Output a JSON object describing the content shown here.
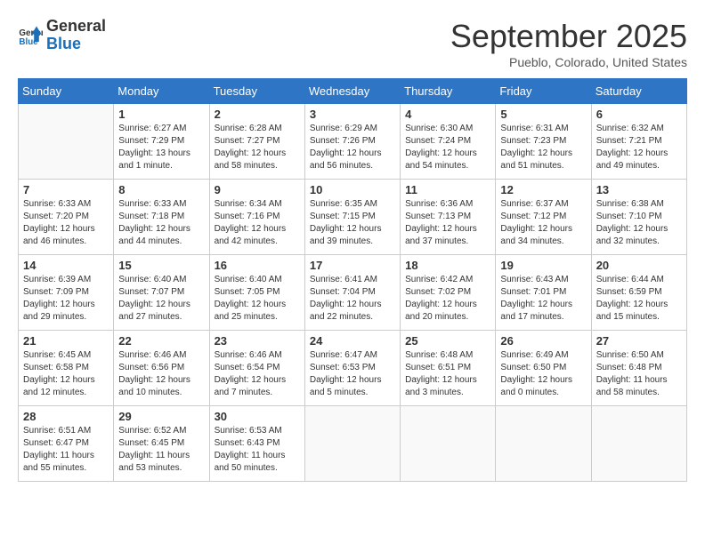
{
  "logo": {
    "line1": "General",
    "line2": "Blue"
  },
  "title": "September 2025",
  "subtitle": "Pueblo, Colorado, United States",
  "days_header": [
    "Sunday",
    "Monday",
    "Tuesday",
    "Wednesday",
    "Thursday",
    "Friday",
    "Saturday"
  ],
  "weeks": [
    [
      {
        "day": "",
        "info": ""
      },
      {
        "day": "1",
        "info": "Sunrise: 6:27 AM\nSunset: 7:29 PM\nDaylight: 13 hours\nand 1 minute."
      },
      {
        "day": "2",
        "info": "Sunrise: 6:28 AM\nSunset: 7:27 PM\nDaylight: 12 hours\nand 58 minutes."
      },
      {
        "day": "3",
        "info": "Sunrise: 6:29 AM\nSunset: 7:26 PM\nDaylight: 12 hours\nand 56 minutes."
      },
      {
        "day": "4",
        "info": "Sunrise: 6:30 AM\nSunset: 7:24 PM\nDaylight: 12 hours\nand 54 minutes."
      },
      {
        "day": "5",
        "info": "Sunrise: 6:31 AM\nSunset: 7:23 PM\nDaylight: 12 hours\nand 51 minutes."
      },
      {
        "day": "6",
        "info": "Sunrise: 6:32 AM\nSunset: 7:21 PM\nDaylight: 12 hours\nand 49 minutes."
      }
    ],
    [
      {
        "day": "7",
        "info": "Sunrise: 6:33 AM\nSunset: 7:20 PM\nDaylight: 12 hours\nand 46 minutes."
      },
      {
        "day": "8",
        "info": "Sunrise: 6:33 AM\nSunset: 7:18 PM\nDaylight: 12 hours\nand 44 minutes."
      },
      {
        "day": "9",
        "info": "Sunrise: 6:34 AM\nSunset: 7:16 PM\nDaylight: 12 hours\nand 42 minutes."
      },
      {
        "day": "10",
        "info": "Sunrise: 6:35 AM\nSunset: 7:15 PM\nDaylight: 12 hours\nand 39 minutes."
      },
      {
        "day": "11",
        "info": "Sunrise: 6:36 AM\nSunset: 7:13 PM\nDaylight: 12 hours\nand 37 minutes."
      },
      {
        "day": "12",
        "info": "Sunrise: 6:37 AM\nSunset: 7:12 PM\nDaylight: 12 hours\nand 34 minutes."
      },
      {
        "day": "13",
        "info": "Sunrise: 6:38 AM\nSunset: 7:10 PM\nDaylight: 12 hours\nand 32 minutes."
      }
    ],
    [
      {
        "day": "14",
        "info": "Sunrise: 6:39 AM\nSunset: 7:09 PM\nDaylight: 12 hours\nand 29 minutes."
      },
      {
        "day": "15",
        "info": "Sunrise: 6:40 AM\nSunset: 7:07 PM\nDaylight: 12 hours\nand 27 minutes."
      },
      {
        "day": "16",
        "info": "Sunrise: 6:40 AM\nSunset: 7:05 PM\nDaylight: 12 hours\nand 25 minutes."
      },
      {
        "day": "17",
        "info": "Sunrise: 6:41 AM\nSunset: 7:04 PM\nDaylight: 12 hours\nand 22 minutes."
      },
      {
        "day": "18",
        "info": "Sunrise: 6:42 AM\nSunset: 7:02 PM\nDaylight: 12 hours\nand 20 minutes."
      },
      {
        "day": "19",
        "info": "Sunrise: 6:43 AM\nSunset: 7:01 PM\nDaylight: 12 hours\nand 17 minutes."
      },
      {
        "day": "20",
        "info": "Sunrise: 6:44 AM\nSunset: 6:59 PM\nDaylight: 12 hours\nand 15 minutes."
      }
    ],
    [
      {
        "day": "21",
        "info": "Sunrise: 6:45 AM\nSunset: 6:58 PM\nDaylight: 12 hours\nand 12 minutes."
      },
      {
        "day": "22",
        "info": "Sunrise: 6:46 AM\nSunset: 6:56 PM\nDaylight: 12 hours\nand 10 minutes."
      },
      {
        "day": "23",
        "info": "Sunrise: 6:46 AM\nSunset: 6:54 PM\nDaylight: 12 hours\nand 7 minutes."
      },
      {
        "day": "24",
        "info": "Sunrise: 6:47 AM\nSunset: 6:53 PM\nDaylight: 12 hours\nand 5 minutes."
      },
      {
        "day": "25",
        "info": "Sunrise: 6:48 AM\nSunset: 6:51 PM\nDaylight: 12 hours\nand 3 minutes."
      },
      {
        "day": "26",
        "info": "Sunrise: 6:49 AM\nSunset: 6:50 PM\nDaylight: 12 hours\nand 0 minutes."
      },
      {
        "day": "27",
        "info": "Sunrise: 6:50 AM\nSunset: 6:48 PM\nDaylight: 11 hours\nand 58 minutes."
      }
    ],
    [
      {
        "day": "28",
        "info": "Sunrise: 6:51 AM\nSunset: 6:47 PM\nDaylight: 11 hours\nand 55 minutes."
      },
      {
        "day": "29",
        "info": "Sunrise: 6:52 AM\nSunset: 6:45 PM\nDaylight: 11 hours\nand 53 minutes."
      },
      {
        "day": "30",
        "info": "Sunrise: 6:53 AM\nSunset: 6:43 PM\nDaylight: 11 hours\nand 50 minutes."
      },
      {
        "day": "",
        "info": ""
      },
      {
        "day": "",
        "info": ""
      },
      {
        "day": "",
        "info": ""
      },
      {
        "day": "",
        "info": ""
      }
    ]
  ]
}
